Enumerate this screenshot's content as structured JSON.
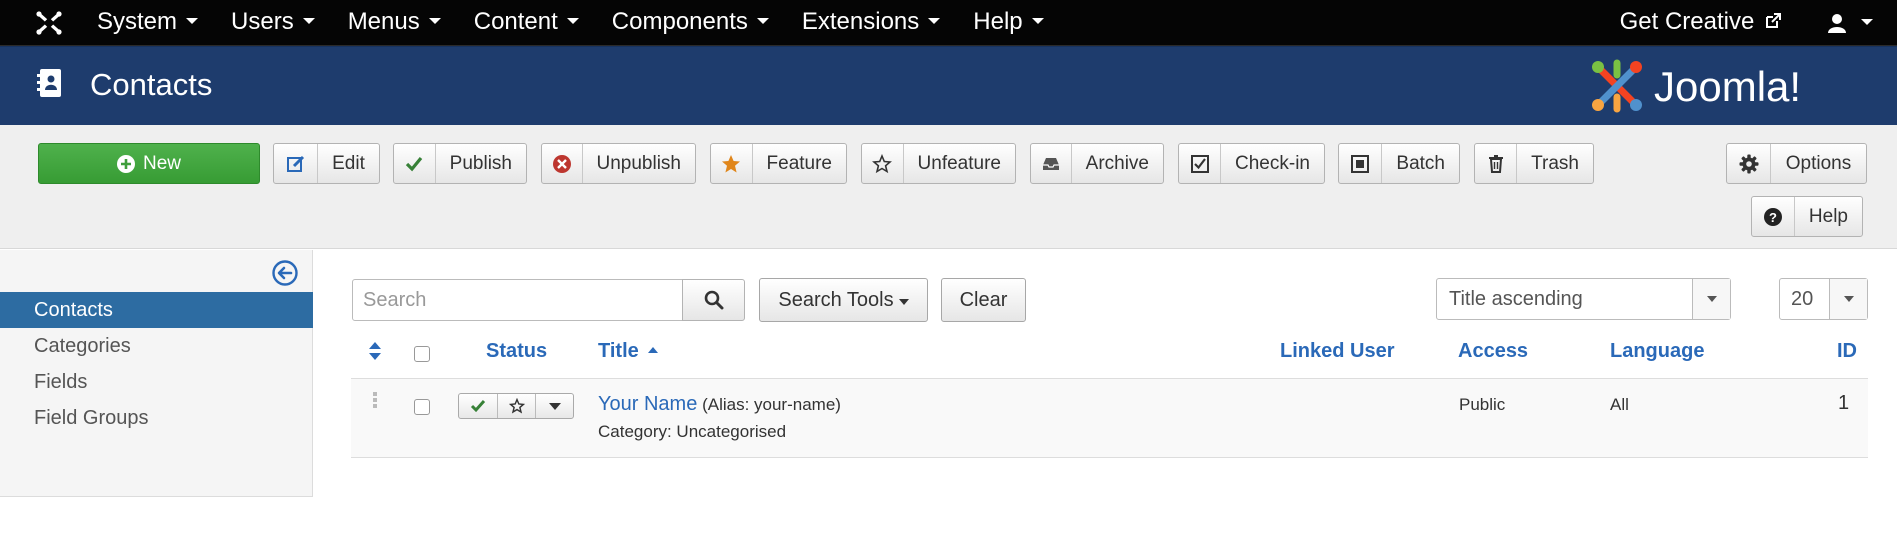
{
  "topnav": {
    "items": [
      "System",
      "Users",
      "Menus",
      "Content",
      "Components",
      "Extensions",
      "Help"
    ],
    "get_creative": "Get Creative"
  },
  "header": {
    "title": "Contacts",
    "brand": "Joomla!"
  },
  "toolbar": {
    "new": "New",
    "edit": "Edit",
    "publish": "Publish",
    "unpublish": "Unpublish",
    "feature": "Feature",
    "unfeature": "Unfeature",
    "archive": "Archive",
    "checkin": "Check-in",
    "batch": "Batch",
    "trash": "Trash",
    "options": "Options",
    "help": "Help"
  },
  "sidebar": {
    "items": [
      {
        "label": "Contacts",
        "active": true
      },
      {
        "label": "Categories",
        "active": false
      },
      {
        "label": "Fields",
        "active": false
      },
      {
        "label": "Field Groups",
        "active": false
      }
    ]
  },
  "filters": {
    "search_placeholder": "Search",
    "search_tools": "Search Tools",
    "clear": "Clear",
    "ordering": "Title ascending",
    "limit": "20"
  },
  "table": {
    "headers": {
      "status": "Status",
      "title": "Title",
      "linked_user": "Linked User",
      "access": "Access",
      "language": "Language",
      "id": "ID"
    },
    "rows": [
      {
        "title": "Your Name",
        "alias": "(Alias: your-name)",
        "category": "Category: Uncategorised",
        "linked_user": "",
        "access": "Public",
        "language": "All",
        "id": "1"
      }
    ]
  },
  "colors": {
    "navbar": "#050505",
    "header": "#1e3c6d",
    "new_button": "#3f9e3c",
    "active_sidebar": "#2d6ca2",
    "link": "#2a69b8"
  }
}
